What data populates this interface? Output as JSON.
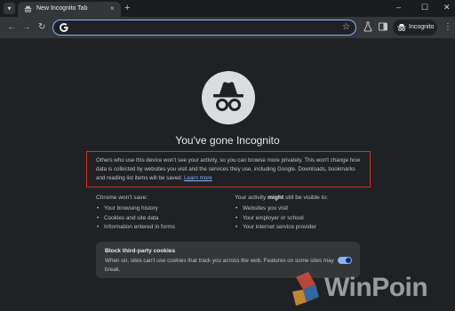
{
  "tab": {
    "title": "New Incognito Tab",
    "close_glyph": "×",
    "new_tab_glyph": "+"
  },
  "window_controls": {
    "minimize": "–",
    "maximize": "☐",
    "close": "✕"
  },
  "toolbar": {
    "back": "←",
    "forward": "→",
    "reload": "↻",
    "search_value": "",
    "star": "☆",
    "incognito_label": "Incognito",
    "menu": "⋮"
  },
  "page": {
    "title": "You've gone Incognito",
    "info_text": "Others who use this device won't see your activity, so you can browse more privately. This won't change how data is collected by websites you visit and the services they use, including Google. Downloads, bookmarks and reading list items will be saved.",
    "learn_more": "Learn more"
  },
  "left_column": {
    "heading": "Chrome won't save:",
    "items": [
      "Your browsing history",
      "Cookies and site data",
      "Information entered in forms"
    ]
  },
  "right_column": {
    "heading_prefix": "Your activity ",
    "heading_bold": "might",
    "heading_suffix": " still be visible to:",
    "items": [
      "Websites you visit",
      "Your employer or school",
      "Your internet service provider"
    ]
  },
  "cookies": {
    "title": "Block third-party cookies",
    "description": "When on, sites can't use cookies that track you across the web. Features on some sites may break.",
    "enabled": true
  },
  "watermark": {
    "text": "WinPoin"
  },
  "colors": {
    "accent": "#8ab4f8",
    "highlight_border": "#d93025",
    "background": "#202124"
  }
}
